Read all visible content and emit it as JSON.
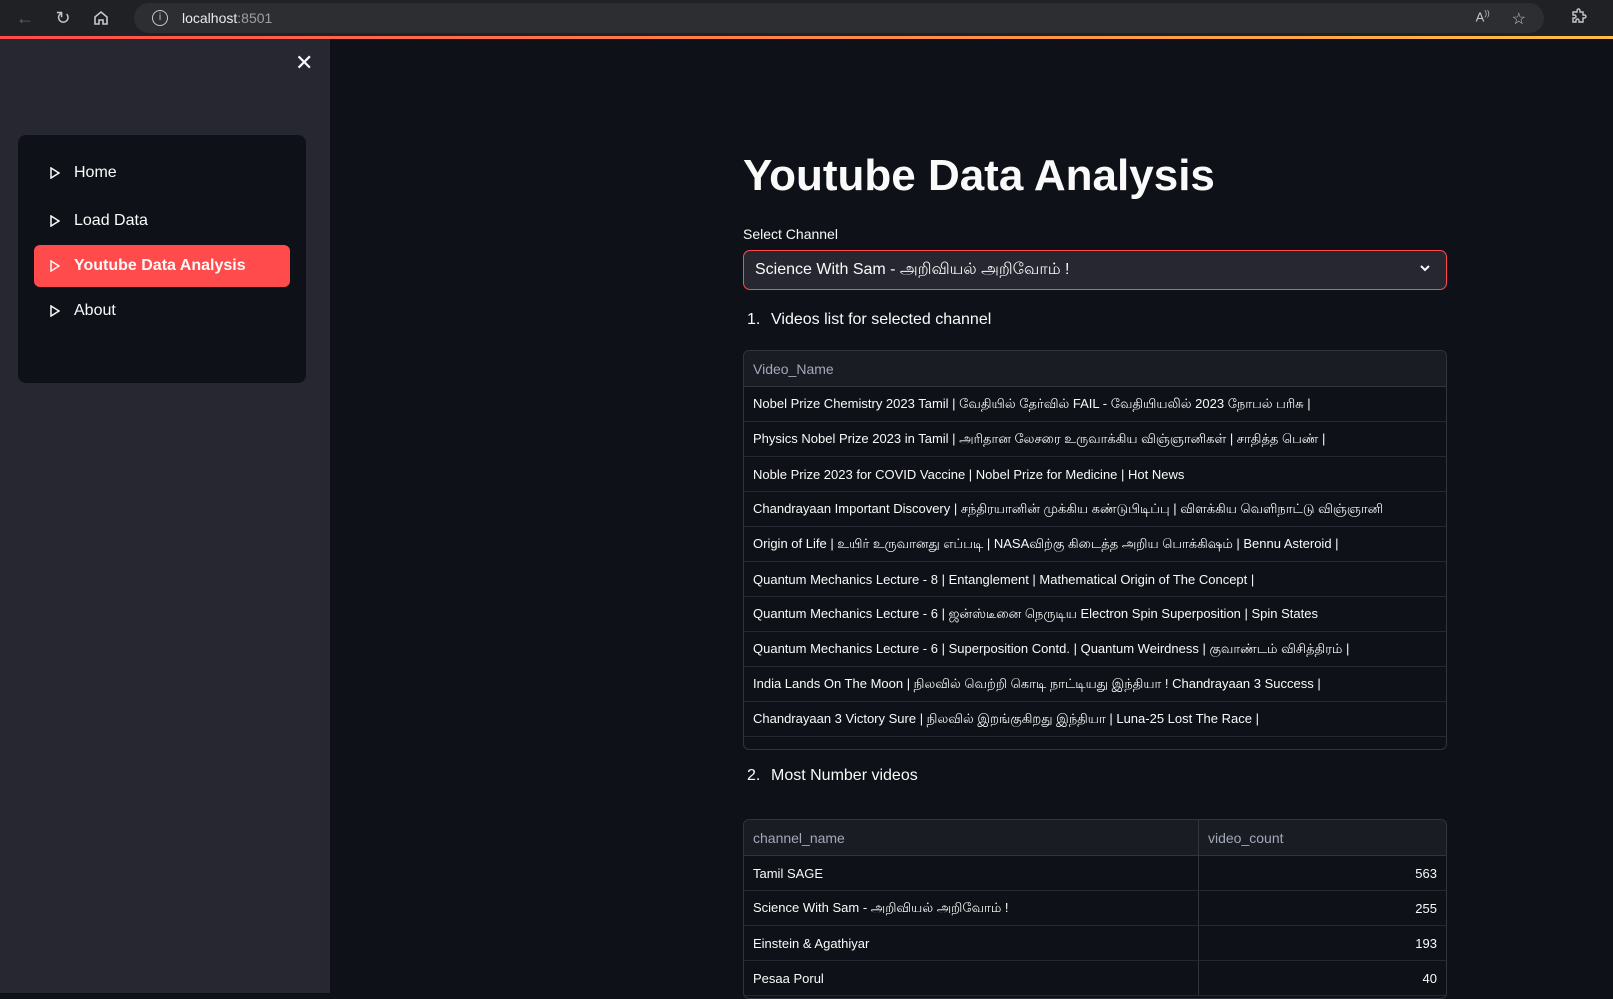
{
  "browser": {
    "url_host": "localhost",
    "url_port": ":8501",
    "back_icon": "back-arrow-icon",
    "reload_icon": "reload-icon",
    "home_icon": "home-icon",
    "read_aloud_icon": "read-aloud-icon",
    "favorite_icon": "star-icon",
    "extensions_icon": "extensions-icon"
  },
  "sidebar": {
    "items": [
      {
        "label": "Home"
      },
      {
        "label": "Load Data"
      },
      {
        "label": "Youtube Data Analysis",
        "active": true
      },
      {
        "label": "About"
      }
    ]
  },
  "main": {
    "title": "Youtube Data Analysis",
    "select_label": "Select Channel",
    "selected_channel": "Science With Sam - அறிவியல் அறிவோம் !",
    "section1": {
      "num": "1.",
      "heading": "Videos list for selected channel"
    },
    "videos_table": {
      "header": "Video_Name",
      "rows": [
        "Nobel Prize Chemistry 2023 Tamil | வேதியில் தேர்வில் FAIL - வேதியியலில் 2023 நோபல் பரிசு |",
        "Physics Nobel Prize 2023 in Tamil | அரிதான லேசரை உருவாக்கிய விஞ்ஞானிகள் | சாதித்த பெண் |",
        "Noble Prize 2023 for COVID Vaccine | Nobel Prize for Medicine | Hot News",
        "Chandrayaan Important Discovery | சந்திரயானின் முக்கிய கண்டுபிடிப்பு | விளக்கிய வெளிநாட்டு விஞ்ஞானி",
        "Origin of Life | உயிர் உருவானது எப்படி | NASAவிற்கு கிடைத்த அறிய பொக்கிஷம் | Bennu Asteroid |",
        "Quantum Mechanics Lecture - 8 | Entanglement | Mathematical Origin of The Concept |",
        "Quantum Mechanics Lecture - 6 | ஜன்ஸ்டீனை நெருடிய Electron Spin Superposition | Spin States",
        "Quantum Mechanics Lecture - 6 | Superposition Contd. | Quantum Weirdness | குவாண்டம் விசித்திரம் |",
        "India Lands On The Moon | நிலவில் வெற்றி கொடி நாட்டியது இந்தியா ! Chandrayaan 3 Success |",
        "Chandrayaan 3 Victory Sure | நிலவில் இறங்குகிறது இந்தியா | Luna-25 Lost The Race |"
      ]
    },
    "section2": {
      "num": "2.",
      "heading": "Most Number videos"
    },
    "count_table": {
      "headers": [
        "channel_name",
        "video_count"
      ],
      "rows": [
        {
          "channel_name": "Tamil SAGE",
          "video_count": "563"
        },
        {
          "channel_name": "Science With Sam - அறிவியல் அறிவோம் !",
          "video_count": "255"
        },
        {
          "channel_name": "Einstein & Agathiyar",
          "video_count": "193"
        },
        {
          "channel_name": "Pesaa Porul",
          "video_count": "40"
        }
      ]
    }
  },
  "colors": {
    "accent": "#ff4b4b",
    "background": "#0e1117",
    "sidebar": "#262730"
  }
}
